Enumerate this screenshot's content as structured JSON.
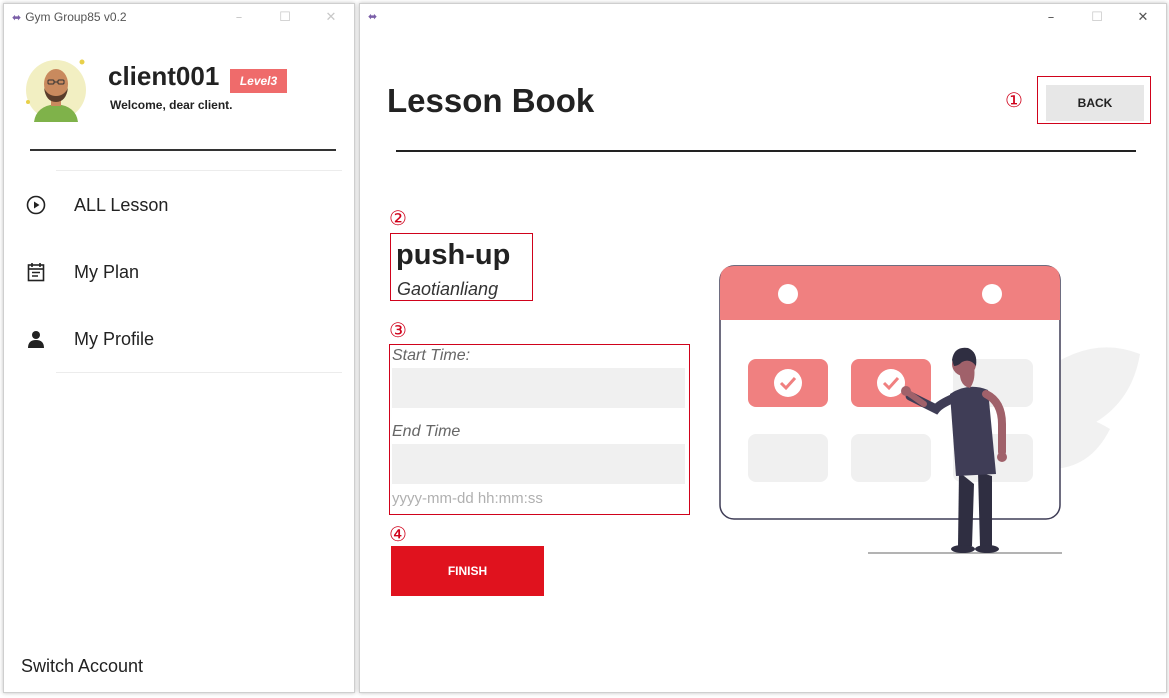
{
  "left_window": {
    "title": "Gym Group85 v0.2",
    "profile": {
      "username": "client001",
      "level": "Level3",
      "welcome": "Welcome, dear client."
    },
    "nav": [
      {
        "label": "ALL Lesson",
        "icon": "play-circle-icon"
      },
      {
        "label": "My Plan",
        "icon": "calendar-icon"
      },
      {
        "label": "My Profile",
        "icon": "person-icon"
      }
    ],
    "switch_account": "Switch Account"
  },
  "right_window": {
    "page_title": "Lesson Book",
    "back_label": "BACK",
    "lesson": {
      "name": "push-up",
      "teacher": "Gaotianliang"
    },
    "form": {
      "start_label": "Start Time:",
      "start_value": "",
      "end_label": "End Time",
      "end_value": "",
      "format_hint": "yyyy-mm-dd hh:mm:ss"
    },
    "finish_label": "FINISH"
  },
  "annotations": [
    "①",
    "②",
    "③",
    "④"
  ],
  "colors": {
    "accent_red": "#e0121e",
    "badge_red": "#ef6b6b",
    "annotation_red": "#d0021b",
    "calendar_pink": "#f08080"
  }
}
